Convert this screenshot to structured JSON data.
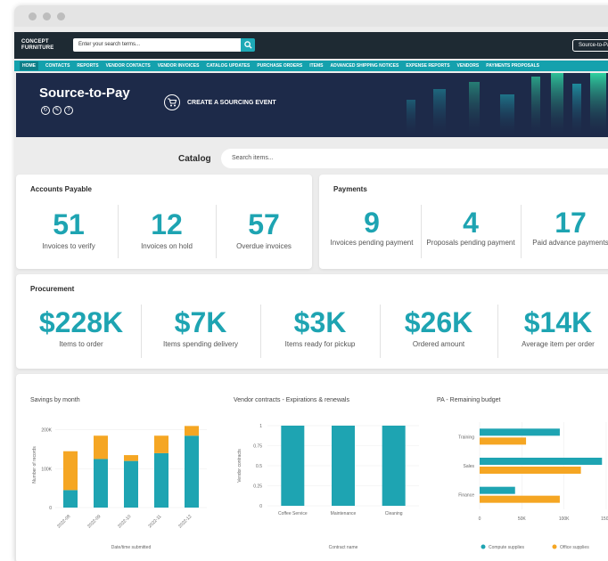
{
  "window": {
    "dots": 3
  },
  "topbar": {
    "logo_text": "CONCEPT FURNITURE",
    "search_placeholder": "Enter your search terms...",
    "right_button": "Source-to-Pay"
  },
  "nav": {
    "items": [
      "HOME",
      "CONTACTS",
      "REPORTS",
      "VENDOR CONTACTS",
      "VENDOR INVOICES",
      "CATALOG UPDATES",
      "PURCHASE ORDERS",
      "ITEMS",
      "ADVANCED SHIPPING NOTICES",
      "EXPENSE REPORTS",
      "VENDORS",
      "PAYMENTS PROPOSALS"
    ],
    "active": "HOME"
  },
  "hero": {
    "title": "Source-to-Pay",
    "cta_label": "CREATE A SOURCING EVENT",
    "icons": [
      "refresh-icon",
      "edit-icon",
      "help-icon"
    ]
  },
  "catalog": {
    "label": "Catalog",
    "placeholder": "Search items..."
  },
  "accounts_payable": {
    "title": "Accounts Payable",
    "metrics": [
      {
        "value": "51",
        "label": "Invoices to verify"
      },
      {
        "value": "12",
        "label": "Invoices on hold"
      },
      {
        "value": "57",
        "label": "Overdue invoices"
      }
    ]
  },
  "payments": {
    "title": "Payments",
    "metrics": [
      {
        "value": "9",
        "label": "Invoices pending payment"
      },
      {
        "value": "4",
        "label": "Proposals pending payment"
      },
      {
        "value": "17",
        "label": "Paid advance payments"
      }
    ]
  },
  "procurement": {
    "title": "Procurement",
    "metrics": [
      {
        "value": "$228K",
        "label": "Items to order"
      },
      {
        "value": "$7K",
        "label": "Items spending delivery"
      },
      {
        "value": "$3K",
        "label": "Items ready for pickup"
      },
      {
        "value": "$26K",
        "label": "Ordered amount"
      },
      {
        "value": "$14K",
        "label": "Average item per order"
      }
    ]
  },
  "colors": {
    "teal": "#1ea4b2",
    "orange": "#f5a623",
    "navy": "#1d2a49",
    "nav": "#14a1ad"
  },
  "chart_data": [
    {
      "type": "bar",
      "title": "Savings by month",
      "xlabel": "Date/time submitted",
      "ylabel": "Number of records",
      "categories": [
        "2022-08",
        "2022-09",
        "2022-10",
        "2022-11",
        "2022-12"
      ],
      "yticks": [
        "0",
        "100K",
        "200K"
      ],
      "ylim": [
        0,
        220000
      ],
      "stacked": true,
      "series": [
        {
          "values": [
            45000,
            125000,
            120000,
            140000,
            185000
          ],
          "color": "#1ea4b2"
        },
        {
          "values": [
            100000,
            60000,
            15000,
            45000,
            25000
          ],
          "color": "#f5a623"
        }
      ]
    },
    {
      "type": "bar",
      "title": "Vendor contracts - Expirations & renewals",
      "xlabel": "Contract name",
      "ylabel": "Vendor contracts",
      "categories": [
        "Coffee Service",
        "Maintenance",
        "Cleaning"
      ],
      "yticks": [
        "0",
        "0.25",
        "0.5",
        "0.75",
        "1"
      ],
      "ylim": [
        0,
        1
      ],
      "series": [
        {
          "values": [
            1,
            1,
            1
          ],
          "color": "#1ea4b2"
        }
      ]
    },
    {
      "type": "bar",
      "orientation": "horizontal",
      "title": "PA - Remaining budget",
      "categories": [
        "Training",
        "Sales",
        "Finance"
      ],
      "xticks": [
        "0",
        "50K",
        "100K",
        "150K"
      ],
      "xlim": [
        0,
        150000
      ],
      "series": [
        {
          "name": "Compute supplies",
          "values": [
            95000,
            145000,
            42000
          ],
          "color": "#1ea4b2"
        },
        {
          "name": "Office supplies",
          "values": [
            55000,
            120000,
            95000
          ],
          "color": "#f5a623"
        }
      ]
    }
  ]
}
